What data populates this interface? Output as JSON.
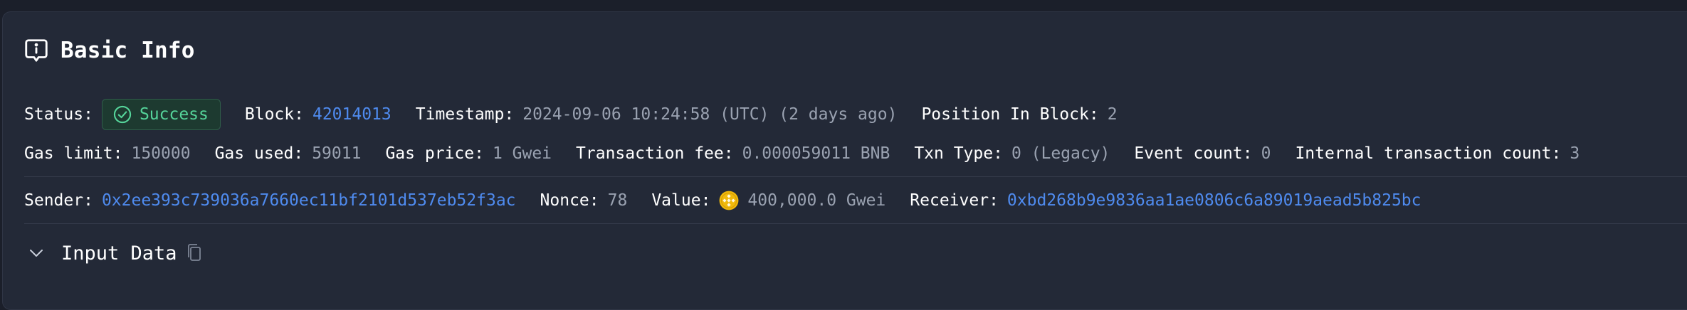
{
  "section": {
    "title": "Basic Info",
    "icon": "info-message-icon"
  },
  "status": {
    "label": "Status:",
    "value": "Success",
    "icon": "check-circle-icon",
    "color": "#55d49a"
  },
  "block": {
    "label": "Block:",
    "value": "42014013"
  },
  "timestamp": {
    "label": "Timestamp:",
    "value": "2024-09-06 10:24:58 (UTC) (2 days ago)"
  },
  "position": {
    "label": "Position In Block:",
    "value": "2"
  },
  "gas_limit": {
    "label": "Gas limit:",
    "value": "150000"
  },
  "gas_used": {
    "label": "Gas used:",
    "value": "59011"
  },
  "gas_price": {
    "label": "Gas price:",
    "value": "1 Gwei"
  },
  "fee": {
    "label": "Transaction fee:",
    "value": "0.000059011 BNB"
  },
  "txn_type": {
    "label": "Txn Type:",
    "value": "0 (Legacy)"
  },
  "event_count": {
    "label": "Event count:",
    "value": "0"
  },
  "internal_count": {
    "label": "Internal transaction count:",
    "value": "3"
  },
  "sender": {
    "label": "Sender:",
    "value": "0x2ee393c739036a7660ec11bf2101d537eb52f3ac"
  },
  "nonce": {
    "label": "Nonce:",
    "value": "78"
  },
  "value": {
    "label": "Value:",
    "value": "400,000.0 Gwei",
    "icon": "bnb-coin-icon"
  },
  "receiver": {
    "label": "Receiver:",
    "value": "0xbd268b9e9836aa1ae0806c6a89019aead5b825bc"
  },
  "input_data": {
    "label": "Input Data",
    "expand_icon": "chevron-down-icon",
    "copy_icon": "copy-icon"
  },
  "colors": {
    "link": "#4f8bef",
    "muted": "#9aa2b1",
    "card_bg": "#232937",
    "page_bg": "#1b1f2a",
    "coin": "#f0b90b"
  }
}
